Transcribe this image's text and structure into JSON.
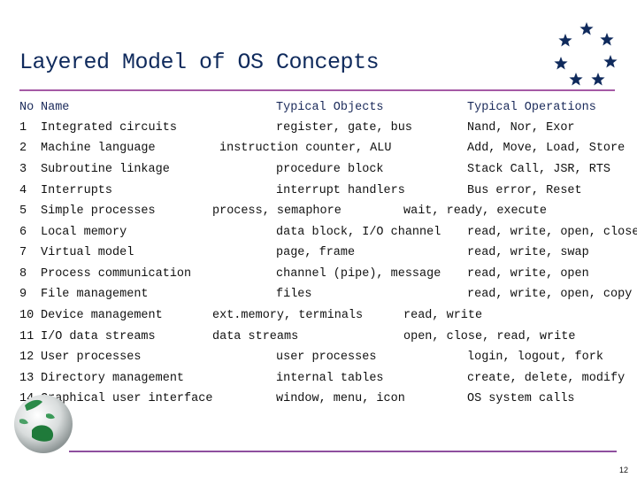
{
  "slide": {
    "title": "Layered Model of OS Concepts",
    "page_number": "12",
    "colors": {
      "title": "#0f2a5c",
      "rule": "#a55aa5",
      "stars": "#0f2a5c"
    }
  },
  "table": {
    "headers": {
      "no": "No",
      "name": "Name",
      "objects": "Typical Objects",
      "operations": "Typical Operations"
    },
    "rows": [
      {
        "no": "1",
        "name": "Integrated circuits",
        "objects": "register, gate, bus",
        "operations": "Nand, Nor, Exor"
      },
      {
        "no": "2",
        "name": "Machine language",
        "objects": "instruction counter, ALU",
        "operations": "Add, Move, Load, Store"
      },
      {
        "no": "3",
        "name": "Subroutine linkage",
        "objects": "procedure block",
        "operations": "Stack Call, JSR, RTS"
      },
      {
        "no": "4",
        "name": "Interrupts",
        "objects": "interrupt handlers",
        "operations": "Bus error, Reset"
      },
      {
        "no": "5",
        "name": "Simple processes",
        "objects": "process, semaphore",
        "operations": "wait, ready, execute"
      },
      {
        "no": "6",
        "name": "Local memory",
        "objects": "data block, I/O channel",
        "operations": "read, write, open, close"
      },
      {
        "no": "7",
        "name": "Virtual model",
        "objects": "page, frame",
        "operations": "read, write, swap"
      },
      {
        "no": "8",
        "name": "Process communication",
        "objects": "channel (pipe), message",
        "operations": "read, write, open"
      },
      {
        "no": "9",
        "name": "File management",
        "objects": "files",
        "operations": "read, write, open, copy"
      },
      {
        "no": "10",
        "name": "Device management",
        "objects": "ext.memory, terminals",
        "operations": "read, write"
      },
      {
        "no": "11",
        "name": "I/O data streams",
        "objects": "data streams",
        "operations": "open, close, read, write"
      },
      {
        "no": "12",
        "name": "User processes",
        "objects": "user processes",
        "operations": "login, logout, fork"
      },
      {
        "no": "13",
        "name": "Directory management",
        "objects": "internal tables",
        "operations": "create, delete, modify"
      },
      {
        "no": "14",
        "name": "Graphical user interface",
        "objects": "window, menu, icon",
        "operations": "OS system calls"
      }
    ]
  },
  "decorations": {
    "stars_icon": "star-ring-icon",
    "globe_icon": "globe-icon"
  }
}
